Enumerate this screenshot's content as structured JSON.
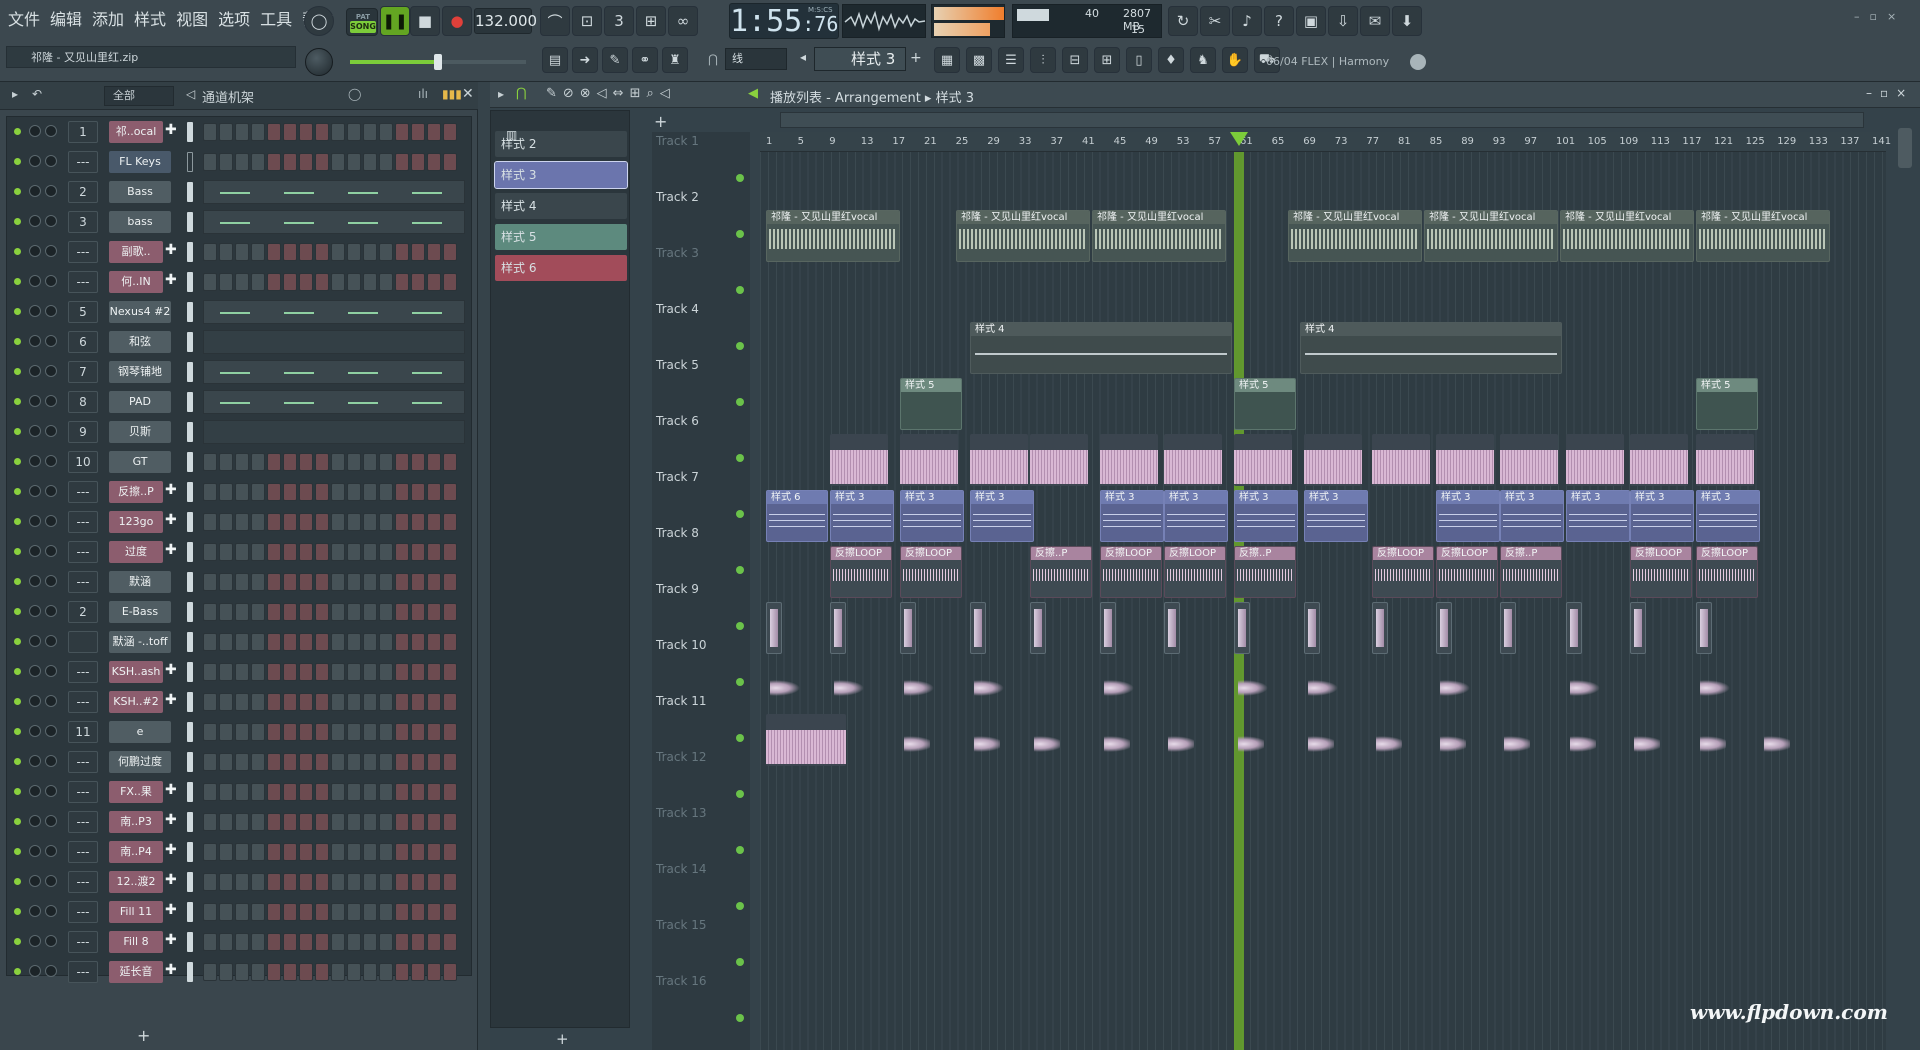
{
  "menu": [
    "文件",
    "编辑",
    "添加",
    "样式",
    "视图",
    "选项",
    "工具",
    "帮助"
  ],
  "transport": {
    "song_label": "SONG",
    "pat_label": "PAT",
    "tempo": "132.000",
    "time": "1:55",
    "time_frac": ":76",
    "time_unit": "M:S:CS"
  },
  "cpu": {
    "cpu": "40",
    "memory": "2807 MB",
    "polyphony": "15"
  },
  "file_label": "祁隆 - 又见山里红.zip",
  "snap": "线",
  "pattern_selector": "样式 3",
  "hint": "06/04  FLEX | Harmony",
  "rack": {
    "filter": "全部",
    "title": "通道机架",
    "channels": [
      {
        "num": "1",
        "name": "祁..ocal",
        "plug": true,
        "type": "steps"
      },
      {
        "num": "---",
        "name": "FL Keys",
        "plug": false,
        "type": "steps",
        "selected": true
      },
      {
        "num": "2",
        "name": "Bass",
        "plug": false,
        "type": "lane"
      },
      {
        "num": "3",
        "name": "bass",
        "plug": false,
        "type": "lane"
      },
      {
        "num": "---",
        "name": "副歌..",
        "plug": true,
        "type": "steps"
      },
      {
        "num": "---",
        "name": "何..IN",
        "plug": true,
        "type": "steps"
      },
      {
        "num": "5",
        "name": "Nexus4 #2",
        "plug": false,
        "type": "lane"
      },
      {
        "num": "6",
        "name": "和弦",
        "plug": false,
        "type": "empty"
      },
      {
        "num": "7",
        "name": "钢琴铺地",
        "plug": false,
        "type": "lane"
      },
      {
        "num": "8",
        "name": "PAD",
        "plug": false,
        "type": "lane"
      },
      {
        "num": "9",
        "name": "贝斯",
        "plug": false,
        "type": "empty"
      },
      {
        "num": "10",
        "name": "GT",
        "plug": false,
        "type": "steps"
      },
      {
        "num": "---",
        "name": "反擦..P",
        "plug": true,
        "type": "steps"
      },
      {
        "num": "---",
        "name": "123go",
        "plug": true,
        "type": "steps"
      },
      {
        "num": "---",
        "name": "过度",
        "plug": true,
        "type": "steps"
      },
      {
        "num": "---",
        "name": "默涵",
        "plug": false,
        "type": "steps"
      },
      {
        "num": "2",
        "name": "E-Bass",
        "plug": false,
        "type": "steps"
      },
      {
        "num": "",
        "name": "默涵 -..toff",
        "plug": false,
        "type": "steps"
      },
      {
        "num": "---",
        "name": "KSH..ash",
        "plug": true,
        "type": "steps"
      },
      {
        "num": "---",
        "name": "KSH..#2",
        "plug": true,
        "type": "steps"
      },
      {
        "num": "11",
        "name": "e",
        "plug": false,
        "type": "steps"
      },
      {
        "num": "---",
        "name": "何鹏过度",
        "plug": false,
        "type": "steps"
      },
      {
        "num": "---",
        "name": "FX..果",
        "plug": true,
        "type": "steps"
      },
      {
        "num": "---",
        "name": "南..P3",
        "plug": true,
        "type": "steps"
      },
      {
        "num": "---",
        "name": "南..P4",
        "plug": true,
        "type": "steps"
      },
      {
        "num": "---",
        "name": "12..渡2",
        "plug": true,
        "type": "steps"
      },
      {
        "num": "---",
        "name": "Fill 11",
        "plug": true,
        "type": "steps"
      },
      {
        "num": "---",
        "name": "Fill 8",
        "plug": true,
        "type": "steps"
      },
      {
        "num": "---",
        "name": "延长音",
        "plug": true,
        "type": "steps"
      }
    ],
    "add": "+"
  },
  "picker": {
    "items": [
      {
        "label": "样式 2",
        "color": "#3a464c"
      },
      {
        "label": "样式 3",
        "color": "#6b75ad",
        "selected": true
      },
      {
        "label": "样式 4",
        "color": "#3a464c"
      },
      {
        "label": "样式 5",
        "color": "#5d8a7e"
      },
      {
        "label": "样式 6",
        "color": "#a24c5a"
      }
    ],
    "add": "+"
  },
  "playlist": {
    "crumb_title": "播放列表",
    "crumb_mode": "Arrangement",
    "crumb_pattern": "样式 3",
    "ruler": [
      "1",
      "5",
      "9",
      "13",
      "17",
      "21",
      "25",
      "29",
      "33",
      "37",
      "41",
      "45",
      "49",
      "53",
      "57",
      "61",
      "65",
      "69",
      "73",
      "77",
      "81",
      "85",
      "89",
      "93",
      "97",
      "101",
      "105",
      "109",
      "113",
      "117",
      "121",
      "125",
      "129",
      "133",
      "137",
      "141"
    ],
    "tracks": [
      "Track 1",
      "Track 2",
      "Track 3",
      "Track 4",
      "Track 5",
      "Track 6",
      "Track 7",
      "Track 8",
      "Track 9",
      "Track 10",
      "Track 11",
      "Track 12",
      "Track 13",
      "Track 14",
      "Track 15",
      "Track 16"
    ],
    "clip_labels": {
      "vocal": "祁隆 - 又见山里红vocal",
      "p4": "样式 4",
      "p5": "样式 5",
      "p3": "样式 3",
      "p6": "样式 6",
      "loop": "反擦LOOP",
      "loop_short": "反擦..P"
    }
  },
  "watermark": "www.flpdown.com"
}
